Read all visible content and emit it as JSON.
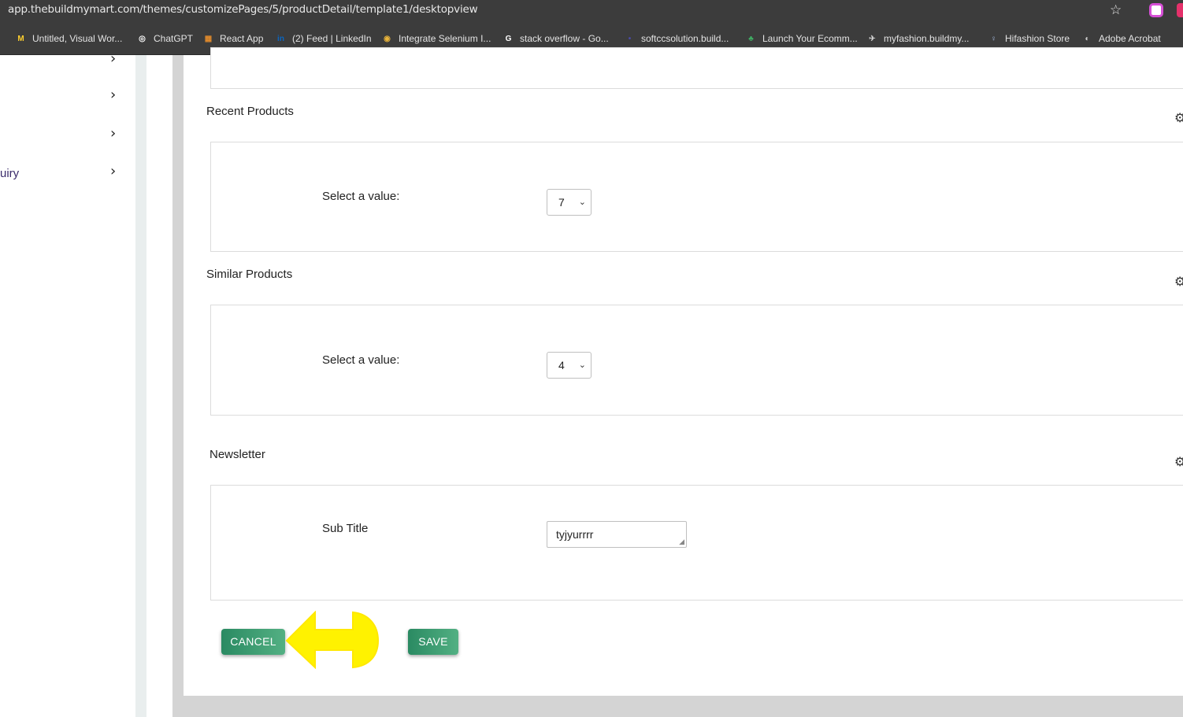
{
  "browser": {
    "url": "app.thebuildmymart.com/themes/customizePages/5/productDetail/template1/desktopview",
    "bookmarks": [
      {
        "label": "Untitled, Visual Wor...",
        "icon": "miro-icon",
        "glyph": "M",
        "color": "#ffd02f"
      },
      {
        "label": "ChatGPT",
        "icon": "chatgpt-icon",
        "glyph": "◎",
        "color": "#ffffff"
      },
      {
        "label": "React App",
        "icon": "react-app-icon",
        "glyph": "▦",
        "color": "#e08a2c"
      },
      {
        "label": "(2) Feed | LinkedIn",
        "icon": "linkedin-icon",
        "glyph": "in",
        "color": "#0a66c2"
      },
      {
        "label": "Integrate Selenium I...",
        "icon": "chrome-icon",
        "glyph": "◉",
        "color": "#e8b33a"
      },
      {
        "label": "stack overflow - Go...",
        "icon": "google-icon",
        "glyph": "G",
        "color": "#ffffff"
      },
      {
        "label": "softccsolution.build...",
        "icon": "site-icon",
        "glyph": "•",
        "color": "#4a4aa8"
      },
      {
        "label": "Launch Your Ecomm...",
        "icon": "ecommerce-icon",
        "glyph": "♣",
        "color": "#3fae64"
      },
      {
        "label": "myfashion.buildmy...",
        "icon": "fashion-icon",
        "glyph": "✈",
        "color": "#cccccc"
      },
      {
        "label": "Hifashion Store",
        "icon": "store-icon",
        "glyph": "♀",
        "color": "#9fb4d8"
      },
      {
        "label": "Adobe Acrobat",
        "icon": "globe-icon",
        "glyph": "◐",
        "color": "#d0d0d0"
      }
    ]
  },
  "sidebar": {
    "partial_label": "uiry",
    "chevron": "›"
  },
  "sections": {
    "recent": {
      "title": "Recent Products",
      "field_label": "Select a value:",
      "value": "7"
    },
    "similar": {
      "title": "Similar Products",
      "field_label": "Select a value:",
      "value": "4"
    },
    "newsletter": {
      "title": "Newsletter",
      "field_label": "Sub Title",
      "value": "tyjyurrrr"
    }
  },
  "actions": {
    "cancel_label": "CANCEL",
    "save_label": "SAVE"
  },
  "colors": {
    "button_start": "#2a8a62",
    "button_end": "#53b083",
    "annotation_arrow": "#fff200"
  }
}
